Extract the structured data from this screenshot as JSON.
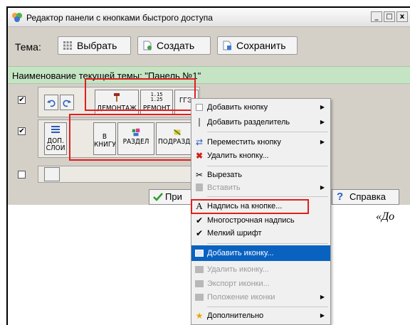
{
  "window": {
    "title": "Редактор панели с кнопками быстрого доступа",
    "controls": {
      "minimize": "_",
      "maximize": "□",
      "close": "x"
    }
  },
  "toolbar": {
    "tema_label": "Тема:",
    "select_label": "Выбрать",
    "create_label": "Создать",
    "save_label": "Сохранить"
  },
  "theme_bar": {
    "text": "Наименование текущей темы: \"Панель №1\""
  },
  "rows": [
    {
      "checked": true,
      "buttons": [
        {
          "label": "",
          "icon": "undo-icon"
        },
        {
          "label": "",
          "icon": "redo-icon"
        },
        {
          "label": "ДЕМОНТАЖ",
          "icon": "hammer-icon"
        },
        {
          "label": "РЕМОНТ",
          "icon": "repair-rates-icon",
          "icon_text": "1.15\n1.25"
        },
        {
          "label": "ГГЭ",
          "icon": ""
        }
      ]
    },
    {
      "checked": true,
      "buttons": [
        {
          "label": "ДОП.\nСЛОИ",
          "icon": "layers-icon"
        },
        {
          "label": "В\nКНИГУ",
          "icon": ""
        },
        {
          "label": "РАЗДЕЛ",
          "icon": "section-icon"
        },
        {
          "label": "ПОДРАЗД",
          "icon": "subsection-icon"
        }
      ]
    },
    {
      "checked": false,
      "buttons": [
        {
          "label": "",
          "icon": ""
        }
      ]
    }
  ],
  "bottom": {
    "ok_label": "При",
    "help_label": "Справка"
  },
  "document": {
    "fragment": "«До"
  },
  "context_menu": {
    "items": [
      {
        "label": "Добавить кнопку",
        "icon": "button-icon",
        "submenu": true,
        "enabled": true
      },
      {
        "label": "Добавить разделитель",
        "icon": "separator-icon",
        "submenu": true,
        "enabled": true
      },
      {
        "label": "Переместить кнопку",
        "icon": "move-icon",
        "submenu": true,
        "enabled": true
      },
      {
        "label": "Удалить кнопку...",
        "icon": "delete-x-icon",
        "submenu": false,
        "enabled": true
      },
      {
        "label": "Вырезать",
        "icon": "scissors-icon",
        "submenu": false,
        "enabled": true
      },
      {
        "label": "Вставить",
        "icon": "paste-icon",
        "submenu": true,
        "enabled": false
      },
      {
        "label": "Надпись на кнопке...",
        "icon": "text-a-icon",
        "submenu": false,
        "enabled": true
      },
      {
        "label": "Многострочная надпись",
        "icon": "checkmark-icon",
        "submenu": false,
        "enabled": true
      },
      {
        "label": "Мелкий шрифт",
        "icon": "checkmark-icon",
        "submenu": false,
        "enabled": true
      },
      {
        "label": "Добавить иконку...",
        "icon": "add-image-icon",
        "submenu": false,
        "enabled": true,
        "selected": true
      },
      {
        "label": "Удалить иконку...",
        "icon": "image-icon",
        "submenu": false,
        "enabled": false
      },
      {
        "label": "Экспорт иконки...",
        "icon": "export-icon",
        "submenu": false,
        "enabled": false
      },
      {
        "label": "Положение иконки",
        "icon": "image-icon",
        "submenu": true,
        "enabled": false
      },
      {
        "label": "Дополнительно",
        "icon": "star-icon",
        "submenu": true,
        "enabled": true
      }
    ]
  },
  "colors": {
    "highlight": "#e11e1e",
    "menu_selection": "#0a62c0",
    "theme_bar": "#c5e4c4"
  }
}
